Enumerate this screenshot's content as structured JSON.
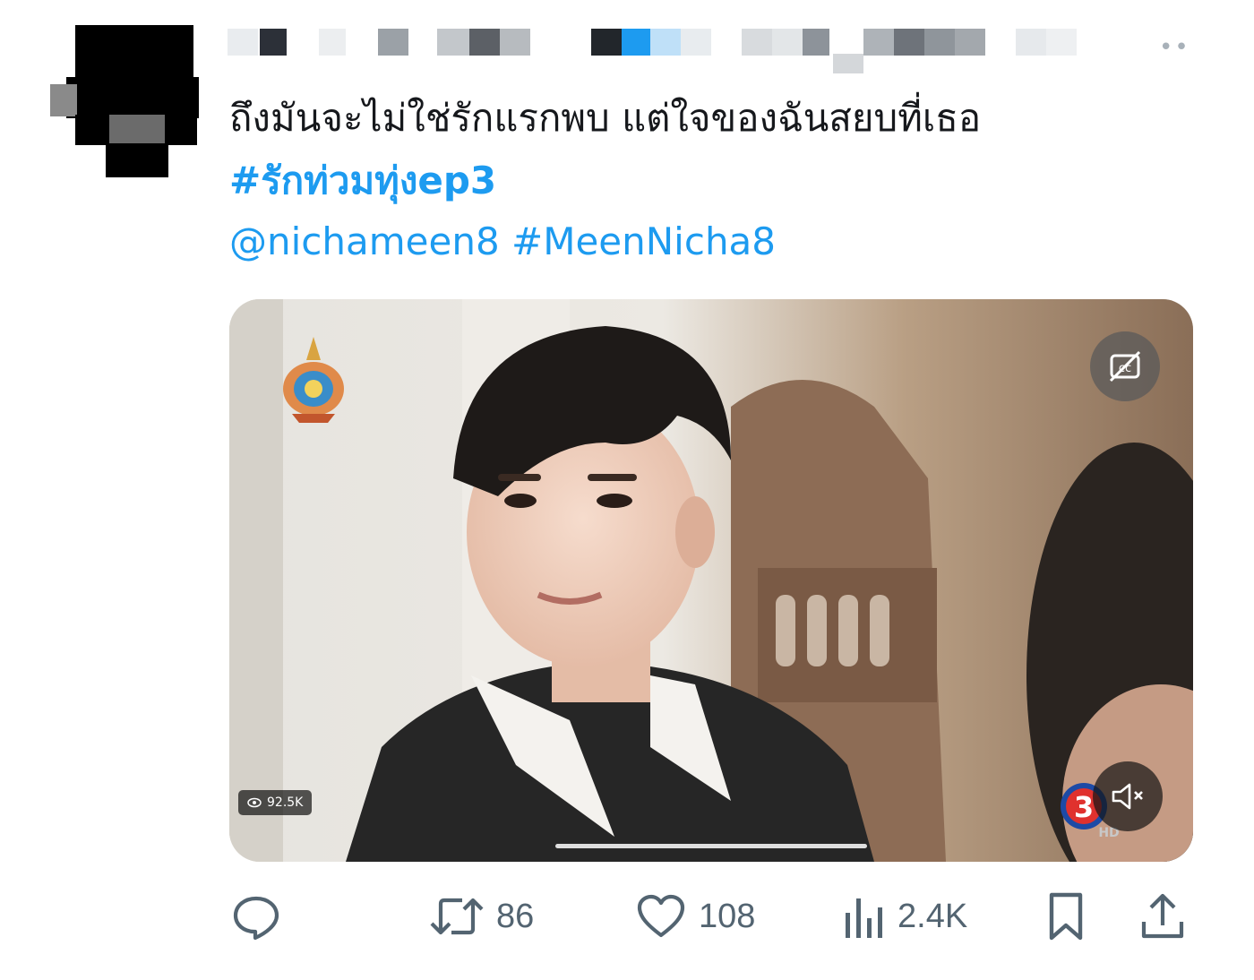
{
  "tweet": {
    "text": "ถึงมันจะไม่ใช่รักแรกพบ แต่ใจของฉันสยบที่เธอ",
    "hashtag": "#รักท่วมทุ่งep3",
    "mention": "@nichameen8",
    "hashtag2": "#MeenNicha8",
    "more_label": "••"
  },
  "media": {
    "views": "92.5K",
    "captions_icon": "closed-captions-off-icon",
    "mute_icon": "speaker-muted-icon",
    "channel_logo": "channel-3-hd-logo",
    "seal": "royal-emblem-logo",
    "progress": 0.33
  },
  "actions": {
    "reply_count": "",
    "retweet_count": "86",
    "like_count": "108",
    "views_count": "2.4K"
  },
  "colors": {
    "link": "#1d9bf0",
    "icon_gray": "#536471",
    "text": "#16181c"
  }
}
